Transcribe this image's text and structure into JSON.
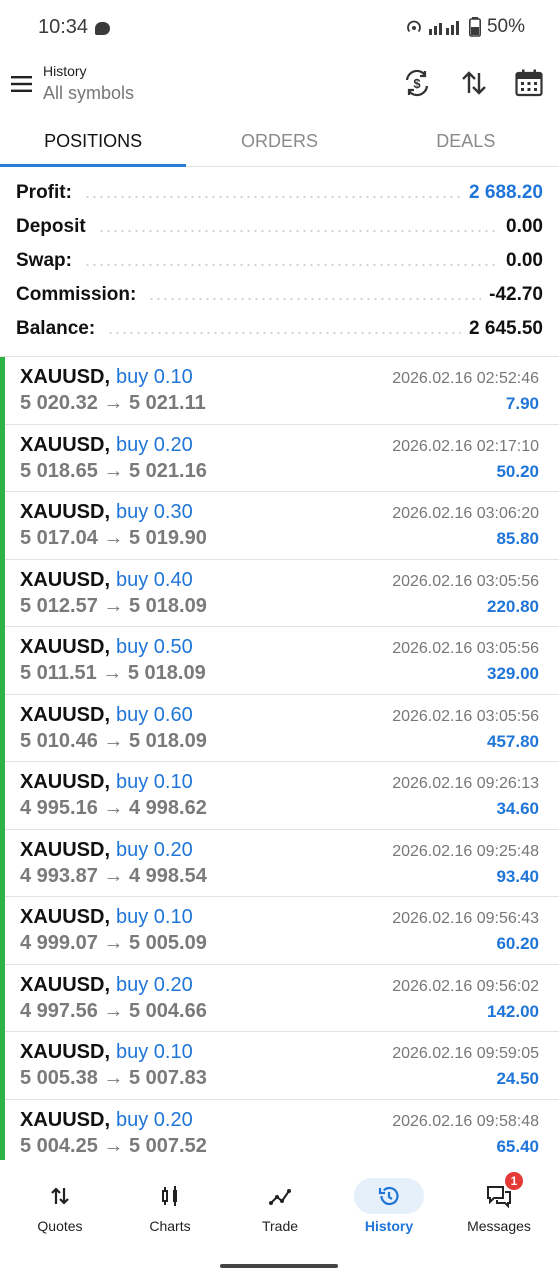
{
  "status_bar": {
    "time": "10:34",
    "battery": "50%"
  },
  "header": {
    "title": "History",
    "subtitle": "All symbols",
    "icons": [
      "menu-icon",
      "currency-exchange-icon",
      "sort-icon",
      "calendar-icon"
    ]
  },
  "tabs": [
    {
      "label": "POSITIONS",
      "active": true
    },
    {
      "label": "ORDERS",
      "active": false
    },
    {
      "label": "DEALS",
      "active": false
    }
  ],
  "summary": {
    "profit": {
      "label": "Profit:",
      "value": "2 688.20"
    },
    "deposit": {
      "label": "Deposit",
      "value": "0.00"
    },
    "swap": {
      "label": "Swap:",
      "value": "0.00"
    },
    "commission": {
      "label": "Commission:",
      "value": "-42.70"
    },
    "balance": {
      "label": "Balance:",
      "value": "2 645.50"
    }
  },
  "deals": [
    {
      "symbol": "XAUUSD,",
      "type": "buy 0.10",
      "prices": "5 020.32 → 5 021.11",
      "time": "2026.02.16 02:52:46",
      "profit": "7.90"
    },
    {
      "symbol": "XAUUSD,",
      "type": "buy 0.20",
      "prices": "5 018.65 → 5 021.16",
      "time": "2026.02.16 02:17:10",
      "profit": "50.20"
    },
    {
      "symbol": "XAUUSD,",
      "type": "buy 0.30",
      "prices": "5 017.04 → 5 019.90",
      "time": "2026.02.16 03:06:20",
      "profit": "85.80"
    },
    {
      "symbol": "XAUUSD,",
      "type": "buy 0.40",
      "prices": "5 012.57 → 5 018.09",
      "time": "2026.02.16 03:05:56",
      "profit": "220.80"
    },
    {
      "symbol": "XAUUSD,",
      "type": "buy 0.50",
      "prices": "5 011.51 → 5 018.09",
      "time": "2026.02.16 03:05:56",
      "profit": "329.00"
    },
    {
      "symbol": "XAUUSD,",
      "type": "buy 0.60",
      "prices": "5 010.46 → 5 018.09",
      "time": "2026.02.16 03:05:56",
      "profit": "457.80"
    },
    {
      "symbol": "XAUUSD,",
      "type": "buy 0.10",
      "prices": "4 995.16 → 4 998.62",
      "time": "2026.02.16 09:26:13",
      "profit": "34.60"
    },
    {
      "symbol": "XAUUSD,",
      "type": "buy 0.20",
      "prices": "4 993.87 → 4 998.54",
      "time": "2026.02.16 09:25:48",
      "profit": "93.40"
    },
    {
      "symbol": "XAUUSD,",
      "type": "buy 0.10",
      "prices": "4 999.07 → 5 005.09",
      "time": "2026.02.16 09:56:43",
      "profit": "60.20"
    },
    {
      "symbol": "XAUUSD,",
      "type": "buy 0.20",
      "prices": "4 997.56 → 5 004.66",
      "time": "2026.02.16 09:56:02",
      "profit": "142.00"
    },
    {
      "symbol": "XAUUSD,",
      "type": "buy 0.10",
      "prices": "5 005.38 → 5 007.83",
      "time": "2026.02.16 09:59:05",
      "profit": "24.50"
    },
    {
      "symbol": "XAUUSD,",
      "type": "buy 0.20",
      "prices": "5 004.25 → 5 007.52",
      "time": "2026.02.16 09:58:48",
      "profit": "65.40"
    }
  ],
  "bottom_nav": [
    {
      "label": "Quotes",
      "icon": "quotes-icon",
      "active": false
    },
    {
      "label": "Charts",
      "icon": "charts-icon",
      "active": false
    },
    {
      "label": "Trade",
      "icon": "trade-icon",
      "active": false
    },
    {
      "label": "History",
      "icon": "history-icon",
      "active": true
    },
    {
      "label": "Messages",
      "icon": "messages-icon",
      "active": false,
      "badge": "1"
    }
  ],
  "colors": {
    "accent": "#1f75d8",
    "buy_bar": "#2fb246",
    "badge": "#e53935"
  }
}
